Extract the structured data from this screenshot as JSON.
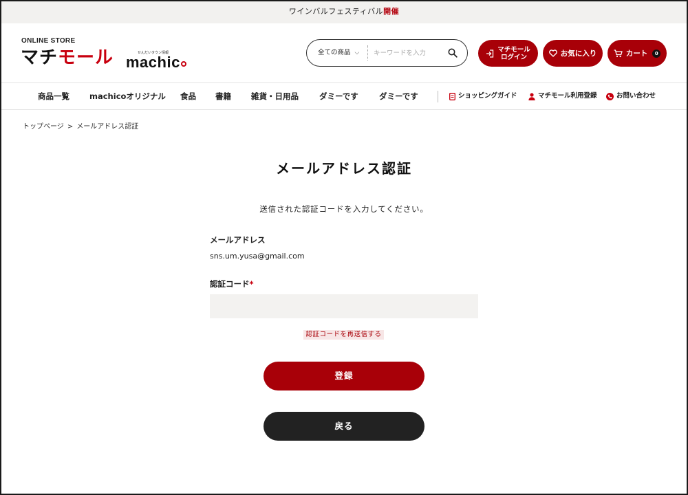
{
  "announcement": {
    "text": "ワインバルフェスティバル",
    "highlight": "開催"
  },
  "header": {
    "store_label": "ONLINE STORE",
    "logo_black": "マチ",
    "logo_red": "モール",
    "machico_sub": "せんだいタウン情報",
    "machico_text": "machic",
    "search": {
      "category": "全ての商品",
      "placeholder": "キーワードを入力"
    },
    "login_line1": "マチモール",
    "login_line2": "ログイン",
    "favorites": "お気に入り",
    "cart": "カート",
    "cart_count": "0"
  },
  "nav": {
    "items": [
      "商品一覧",
      "machicoオリジナル",
      "食品",
      "書籍",
      "雑貨・日用品",
      "ダミーです",
      "ダミーです"
    ],
    "sub": [
      "ショッピングガイド",
      "マチモール利用登録",
      "お問い合わせ"
    ]
  },
  "breadcrumb": {
    "home": "トップページ",
    "separator": ">",
    "current": "メールアドレス認証"
  },
  "main": {
    "title": "メールアドレス認証",
    "intro": "送信された認証コードを入力してください。",
    "email_label": "メールアドレス",
    "email_value": "sns.um.yusa@gmail.com",
    "code_label": "認証コード",
    "required_mark": "*",
    "code_value": "",
    "resend_link": "認証コードを再送信する",
    "register_button": "登録",
    "back_button": "戻る"
  },
  "colors": {
    "brand_red": "#a80008",
    "logo_red": "#c8000f",
    "dark": "#222222",
    "bar_bg": "#f2f1ef"
  }
}
